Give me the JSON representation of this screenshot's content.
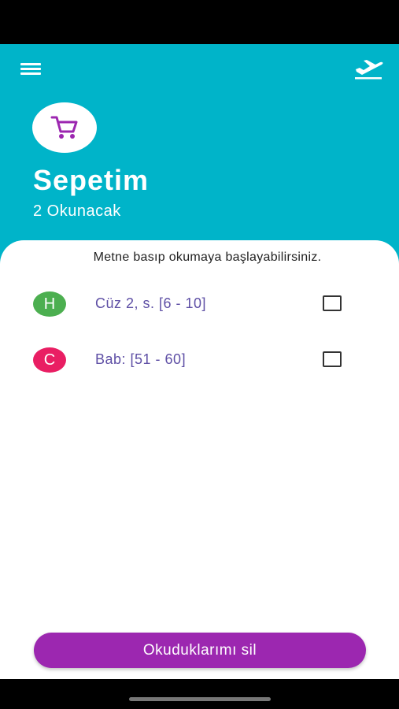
{
  "header": {
    "title": "Sepetim",
    "subtitle": "2 Okunacak",
    "background_color": "#00B4C9",
    "left_icon": "menu-icon",
    "right_icon": "flight-takeoff-icon",
    "cart_icon": "shopping-cart-icon"
  },
  "hint": "Metne basıp okumaya başlayabilirsiniz.",
  "items": [
    {
      "badge": "H",
      "badge_color": "#4CAF50",
      "label": "Cüz 2, s. [6 - 10]",
      "checked": false
    },
    {
      "badge": "C",
      "badge_color": "#E91E63",
      "label": "Bab: [51 - 60]",
      "checked": false
    }
  ],
  "footer": {
    "delete_label": "Okuduklarımı sil",
    "button_color": "#9C27B0"
  }
}
